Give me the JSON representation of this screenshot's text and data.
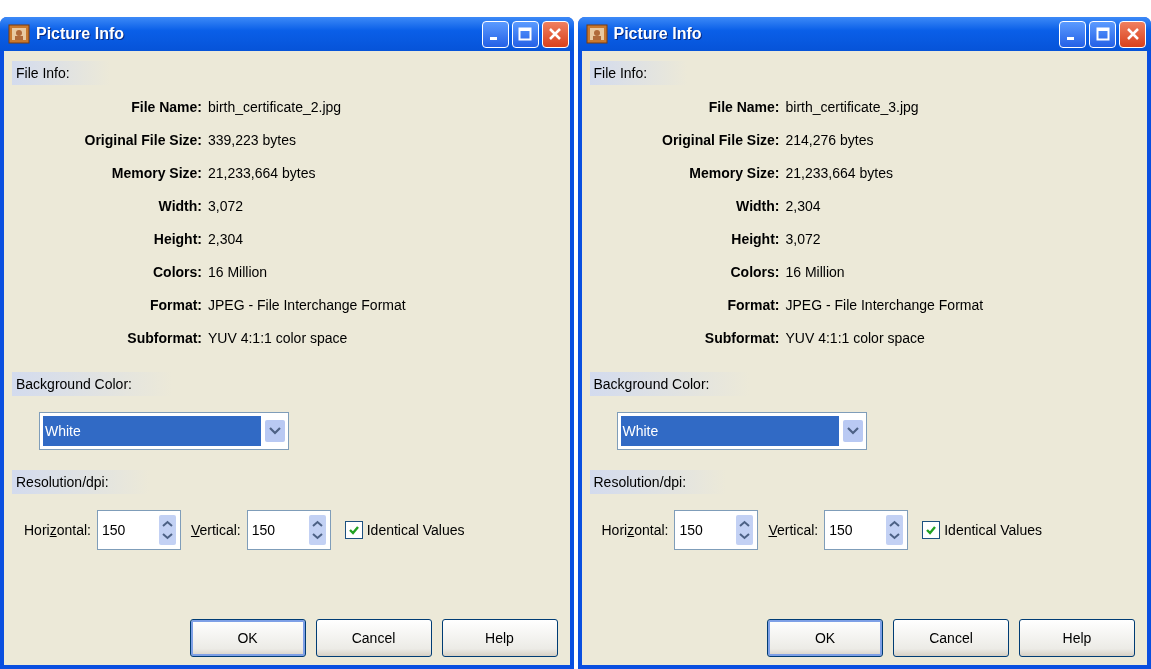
{
  "windows": [
    {
      "title": "Picture Info",
      "file_info": {
        "heading": "File Info:",
        "rows": [
          {
            "label": "File Name:",
            "value": "birth_certificate_2.jpg"
          },
          {
            "label": "Original File Size:",
            "value": "339,223 bytes"
          },
          {
            "label": "Memory Size:",
            "value": "21,233,664 bytes"
          },
          {
            "label": "Width:",
            "value": "3,072"
          },
          {
            "label": "Height:",
            "value": "2,304"
          },
          {
            "label": "Colors:",
            "value": "16 Million"
          },
          {
            "label": "Format:",
            "value": "JPEG - File Interchange Format"
          },
          {
            "label": "Subformat:",
            "value": "YUV 4:1:1 color space"
          }
        ]
      },
      "background_color": {
        "heading": "Background Color:",
        "value": "White",
        "highlighted": true
      },
      "resolution": {
        "heading": "Resolution/dpi:",
        "spinners": [
          {
            "label_before": "Hori",
            "label_mnemonic": "z",
            "label_after": "ontal:",
            "value": "150"
          },
          {
            "label_mnemonic": "V",
            "label_after": "ertical:",
            "value": "150"
          }
        ],
        "identical": {
          "label": "Identical Values",
          "checked": true
        }
      },
      "buttons": [
        {
          "label": "OK",
          "default": true
        },
        {
          "label": "Cancel",
          "default": false
        },
        {
          "label": "Help",
          "default": false
        }
      ]
    },
    {
      "title": "Picture Info",
      "file_info": {
        "heading": "File Info:",
        "rows": [
          {
            "label": "File Name:",
            "value": "birth_certificate_3.jpg"
          },
          {
            "label": "Original File Size:",
            "value": "214,276 bytes"
          },
          {
            "label": "Memory Size:",
            "value": "21,233,664 bytes"
          },
          {
            "label": "Width:",
            "value": "2,304"
          },
          {
            "label": "Height:",
            "value": "3,072"
          },
          {
            "label": "Colors:",
            "value": "16 Million"
          },
          {
            "label": "Format:",
            "value": "JPEG - File Interchange Format"
          },
          {
            "label": "Subformat:",
            "value": "YUV 4:1:1 color space"
          }
        ]
      },
      "background_color": {
        "heading": "Background Color:",
        "value": "White",
        "highlighted": true
      },
      "resolution": {
        "heading": "Resolution/dpi:",
        "spinners": [
          {
            "label_before": "Hori",
            "label_mnemonic": "z",
            "label_after": "ontal:",
            "value": "150"
          },
          {
            "label_mnemonic": "V",
            "label_after": "ertical:",
            "value": "150"
          }
        ],
        "identical": {
          "label": "Identical Values",
          "checked": true
        }
      },
      "buttons": [
        {
          "label": "OK",
          "default": true
        },
        {
          "label": "Cancel",
          "default": false
        },
        {
          "label": "Help",
          "default": false
        }
      ]
    }
  ]
}
